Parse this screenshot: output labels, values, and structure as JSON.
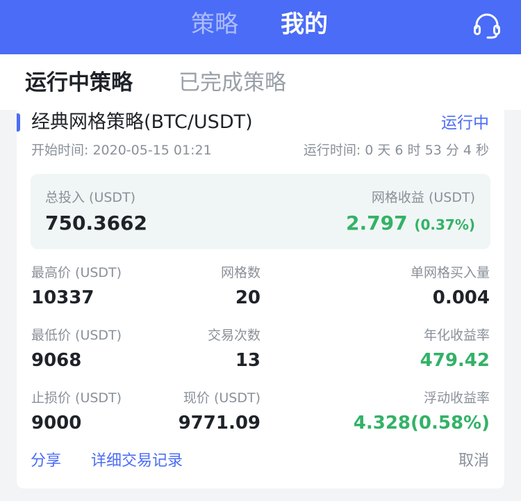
{
  "header": {
    "tabs": [
      "策略",
      "我的"
    ],
    "active_tab": "我的",
    "support_icon": "headset-icon",
    "background": "#4a6cf7"
  },
  "subtabs": {
    "running": "运行中策略",
    "completed": "已完成策略",
    "active": "运行中策略"
  },
  "strategy": {
    "title": "经典网格策略(BTC/USDT)",
    "status": "运行中",
    "start_label": "开始时间:",
    "start_time": "2020-05-15 01:21",
    "run_label": "运行时间:",
    "run_time": "0 天 6 时 53 分 4 秒",
    "summary": {
      "total_invest_label": "总投入 (USDT)",
      "total_invest": "750.3662",
      "grid_profit_label": "网格收益 (USDT)",
      "grid_profit": "2.797",
      "grid_profit_pct": "(0.37%)"
    },
    "stats": {
      "high_price_label": "最高价 (USDT)",
      "high_price": "10337",
      "grid_count_label": "网格数",
      "grid_count": "20",
      "per_grid_label": "单网格买入量",
      "per_grid": "0.004",
      "low_price_label": "最低价 (USDT)",
      "low_price": "9068",
      "trade_count_label": "交易次数",
      "trade_count": "13",
      "annual_label": "年化收益率",
      "annual": "479.42",
      "stop_loss_label": "止损价 (USDT)",
      "stop_loss": "9000",
      "current_price_label": "现价 (USDT)",
      "current_price": "9771.09",
      "float_label": "浮动收益率",
      "float": "4.328(0.58%)"
    },
    "actions": {
      "share": "分享",
      "detail": "详细交易记录",
      "cancel": "取消"
    }
  },
  "colors": {
    "accent": "#4a6cf7",
    "profit": "#33b267",
    "muted": "#8a9099"
  }
}
